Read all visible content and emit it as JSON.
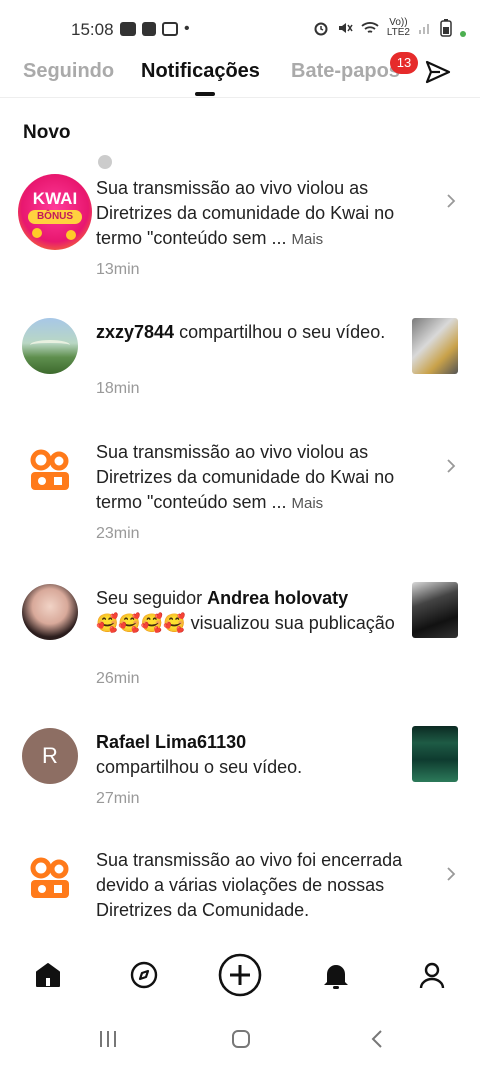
{
  "status_bar": {
    "time": "15:08",
    "dot": "•",
    "network_top": "Vo))",
    "network_bottom": "LTE2"
  },
  "tabs": [
    {
      "label": "Seguindo",
      "active": false
    },
    {
      "label": "Notificações",
      "active": true
    },
    {
      "label": "Bate-papos",
      "active": false
    }
  ],
  "chat_badge": "13",
  "section_title": "Novo",
  "notifications": [
    {
      "avatar": "kwai-bonus-logo",
      "avatar_text_top": "KWAI",
      "avatar_text_bottom": "BÔNUS",
      "text": "Sua transmissão ao vivo violou as Diretrizes da comunidade do Kwai no termo \"conteúdo sem ...",
      "more": "Mais",
      "time": "13min"
    },
    {
      "avatar": "user-photo-landscape",
      "user": "zxzy7844",
      "text": " compartilhou o seu vídeo.",
      "time": "18min"
    },
    {
      "avatar": "kwai-logo",
      "text": "Sua transmissão ao vivo violou as Diretrizes da comunidade do Kwai no termo \"conteúdo sem ...",
      "more": "Mais",
      "time": "23min"
    },
    {
      "avatar": "user-photo-girl",
      "text_prefix": "Seu seguidor ",
      "user": "Andrea holovaty",
      "emojis": "🥰🥰🥰🥰",
      "text_suffix": " visualizou sua publicação",
      "time": "26min"
    },
    {
      "avatar": "letter-avatar",
      "avatar_letter": "R",
      "user": "Rafael Lima61130",
      "text": "compartilhou o seu vídeo.",
      "time": "27min"
    },
    {
      "avatar": "kwai-logo",
      "text": "Sua transmissão ao vivo foi encerrada devido a várias violações de nossas Diretrizes da Comunidade."
    }
  ],
  "colors": {
    "accent": "#e62b2b",
    "kwai_orange": "#ff7a1a",
    "avatar_letter_bg": "#8d6e63"
  },
  "bottom_nav": [
    "home-icon",
    "discover-icon",
    "create-icon",
    "bell-icon",
    "profile-icon"
  ]
}
